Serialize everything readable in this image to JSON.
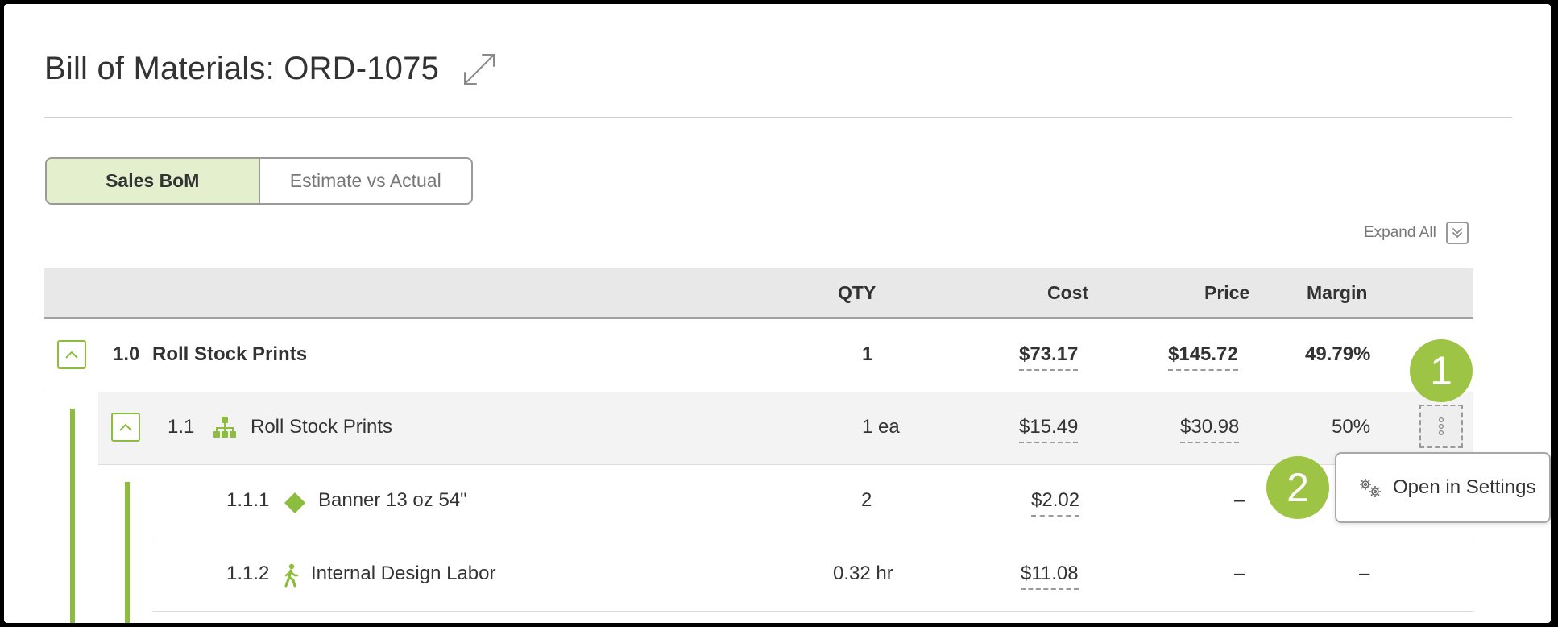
{
  "page": {
    "title": "Bill of Materials: ORD-1075"
  },
  "toggle": {
    "active_label": "Sales BoM",
    "inactive_label": "Estimate vs Actual"
  },
  "expand_all": {
    "label": "Expand All"
  },
  "table": {
    "headers": {
      "qty": "QTY",
      "cost": "Cost",
      "price": "Price",
      "margin": "Margin"
    },
    "rows": [
      {
        "num": "1.0",
        "name": "Roll Stock Prints",
        "qty": "1",
        "cost": "$73.17",
        "price": "$145.72",
        "margin": "49.79%"
      },
      {
        "num": "1.1",
        "name": "Roll Stock Prints",
        "qty": "1 ea",
        "cost": "$15.49",
        "price": "$30.98",
        "margin": "50%",
        "icon": "hierarchy-icon"
      },
      {
        "num": "1.1.1",
        "name": "Banner 13 oz 54\"",
        "qty": "2",
        "cost": "$2.02",
        "price": "–",
        "icon": "diamond-icon"
      },
      {
        "num": "1.1.2",
        "name": "Internal Design Labor",
        "qty": "0.32 hr",
        "cost": "$11.08",
        "price": "–",
        "margin": "–",
        "icon": "walking-person-icon"
      }
    ]
  },
  "callouts": {
    "first": "1",
    "second": "2"
  },
  "context_menu": {
    "open_settings_label": "Open in Settings",
    "icon": "gears-icon"
  },
  "colors": {
    "accent": "#8cbd3f",
    "badge": "#9dc444",
    "active_toggle": "#e4efcd"
  }
}
